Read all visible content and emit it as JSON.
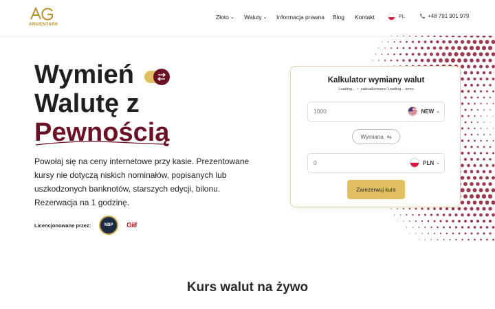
{
  "brand": {
    "name": "ARGENTARII",
    "colors": {
      "gold": "#c9a54a",
      "maroon": "#6b1126"
    }
  },
  "nav": {
    "items": [
      {
        "label": "Złoto",
        "has_dropdown": true
      },
      {
        "label": "Waluty",
        "has_dropdown": true
      },
      {
        "label": "Informacja prawna",
        "has_dropdown": false
      },
      {
        "label": "Blog",
        "has_dropdown": false
      },
      {
        "label": "Kontakt",
        "has_dropdown": false
      }
    ],
    "language": "PL",
    "phone": "+48 791 901 979"
  },
  "hero": {
    "title_line1": "Wymień",
    "title_line2": "Walutę z",
    "title_line3": "Pewnością",
    "description": "Powołaj się na ceny internetowe przy kasie. Prezentowane kursy nie dotyczą niskich nominałów, popisanych lub uszkodzonych banknotów, starszych edycji, bilonu. Rezerwacja na 1 godzinę.",
    "license_label": "Licencjonowane przez:",
    "license_logos": [
      "NBP",
      "Giif"
    ]
  },
  "calculator": {
    "title": "Kalkulator wymiany walut",
    "subtitle_left": "Loading...",
    "subtitle_right": "zaktualizowano Loading... temu",
    "from_amount": "1000",
    "from_currency": "NEW",
    "swap_label": "Wymiana",
    "to_amount": "0",
    "to_currency": "PLN",
    "reserve_label": "Zarezerwuj kurs"
  },
  "section": {
    "title": "Kurs walut na żywo"
  }
}
